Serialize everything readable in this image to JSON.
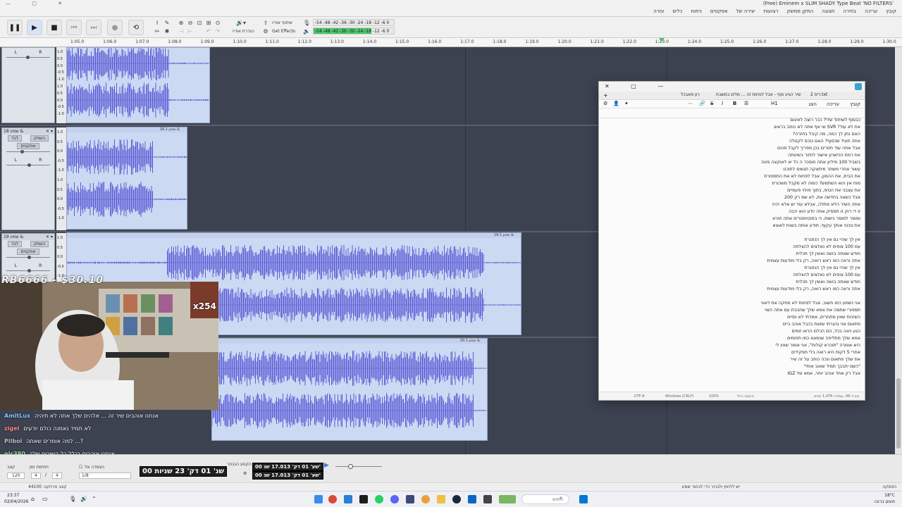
{
  "window": {
    "title": "(Free) Eminem x SLIM SHADY Type Beat 'NO FILTERS'"
  },
  "menu": [
    "קובץ",
    "עריכה",
    "בחירה",
    "תצוגה",
    "התקן ממשק",
    "רצועות",
    "יצירה של",
    "אפקטים",
    "ניתוח",
    "כלים",
    "עזרה"
  ],
  "toolbar": {
    "audio_setup_label": "שיתוף אודיו",
    "get_effects_label": "Get Effects",
    "audio_setup_sub": "הגדרת אודיו",
    "meter_top": "-54 -48 -42 -36 -30 -24 -18 -12 -6 0",
    "meter_bottom": "-54 -48 -42 -36 -30 -24 -18 -12 -6 0"
  },
  "ruler": {
    "ticks": [
      "1:05.0",
      "1:06.0",
      "1:07.0",
      "1:08.0",
      "1:09.0",
      "1:10.0",
      "1:11.0",
      "1:12.0",
      "1:13.0",
      "1:14.0",
      "1:15.0",
      "1:16.0",
      "1:17.0",
      "1:18.0",
      "1:19.0",
      "1:20.0",
      "1:21.0",
      "1:22.0",
      "1:23.0",
      "1:24.0",
      "1:25.0",
      "1:26.0",
      "1:27.0",
      "1:28.0",
      "1:29.0",
      "1:30.0"
    ]
  },
  "tracks": [
    {
      "name": "",
      "mute": "השתק",
      "solo": "לבד",
      "effects": "אפקטים",
      "clip_label": ""
    },
    {
      "name": "שמע 18 &",
      "mute": "השתק",
      "solo": "לבד",
      "effects": "אפקטים",
      "clip_label": "שמע 18.1 &"
    },
    {
      "name": "שמע 19 &",
      "mute": "השתק",
      "solo": "לבד",
      "effects": "אפקטים",
      "clip_label": "שמע 19.1 &"
    },
    {
      "name": "",
      "mute": "",
      "solo": "",
      "effects": "",
      "clip_label": "שמע 20.1 &"
    }
  ],
  "scale_labels": [
    "1.0",
    "0.5",
    "0.0",
    "-0.5",
    "-1.0",
    "1.0",
    "0.5",
    "0.0",
    "-0.5",
    "-1.0"
  ],
  "stream": {
    "donation": "RB6666 - $30.10",
    "gift_count": "x254",
    "chat": [
      {
        "user": "AmitLux",
        "text": "אנחנו אוהבים שיר זה ...  אלהים שלך אתה לא תיהיה"
      },
      {
        "user": "zigel",
        "text": "לא תמיד נאמנה כולם יודעים"
      },
      {
        "user": "Pilboi",
        "text": "למה אומרים שאתה ...?"
      },
      {
        "user": "nlc380",
        "text": "אנחנו אוהבים בגלל כל השירים שלך ..."
      }
    ]
  },
  "notepad": {
    "tabs": [
      "דיס 2.txt",
      "שיר הגיע סוף - אבל לפחות זה ... מלים במשבת",
      "רון מאבכל"
    ],
    "menu": [
      "קובץ",
      "עריכה",
      "הצג"
    ],
    "heading_btn": "H1",
    "lines": [
      "כבסוף לשיחוד שלי? כבר רוצה לאיגום",
      "את לא עוד? SVR שי אף אתה לא כותב בראש",
      "האם נתן לך כמה, מה קיבל בחזרה?",
      "אתה תעיד שכסוף? האם ננכס לקטלה",
      "אבל אתה עוד חוזרים בכן מפריך לקבל סכום",
      "את רמת הכישרון אישור לחזור בשיטתה",
      "בשביל 100 מיליון אתה חוסכר ה כל יא לאוקצה פטה",
      "עשור אחרי משחר מיתאקה תגשים לתוכנו",
      "את הבית, את ההמון, אבל לפחות לא את התספורת",
      "מוח אין הוא השתמש? כשזה לא מקבל משכורת",
      "את עצבני את הטיפ, בתוך פולוי פעמיים",
      "אבל כשאני בחדשה את, לא שם רק 200",
      "אתה השיר הלא מתלה, אבלא עוד יש אלא יהיה",
      "זו די רוק זו תפסיק אתה יודע הוא יכבה",
      "ומוסר למוסר גישות, כי בסנטימטרים אתה חורא",
      "את טכנוי אותך עקוף, תודע אותה בשנת לאוצא",
      "",
      "אין לך שהיי גם אין לך הנפגרת",
      "עם 100 צופים לא נאלצים להצלחה",
      "חודש שאתה בושה ואשין לך תכלית",
      "אתה וראה כמו ראש רואה, רק בלי מודעות עצמית",
      "אין לך שהיי גם אין לך הנפגרת",
      "עם 100 צופים לא נאלצים להצלחה",
      "חודש שאתה בושה ואשין לך תכלית",
      "אתה וראה כמו ראש רואה, רק בלי מודעות עצמית",
      "",
      "אני נשמע כמו חשוב, אבל לפחות לא מחקה את דאווי",
      "תספורי שתמה את אמא שלך שחבבת עם אתה כשוי",
      "השיבות שאין מתחרים, אמרתי לא נסיים",
      "פתאום אני נהגרתי שזאת בכבל אוהב ביים",
      "הגע ויאה בכל, הם הכלם הראו זומים",
      "אמא שלך מתליפה שנמצא כמו תחומים",
      "היא אומרה \"תוכרא קולות\", אני אומר שאין לי",
      "אחרי 5 דקות היא רואה בלי תפקידים",
      "את שלך פתאום ונכה כותב על זה שיר",
      "\"כשם יחבבך תמיד שאוב אותי\"",
      "אבל רק אחד אוהב יותר, אמא של IGZ"
    ],
    "status": {
      "position": "שורה 46, עמודה 1,476 תווים",
      "text_type": "טקסט רגיל",
      "zoom": "100%",
      "line_ending": "Windows (CRLF)",
      "encoding": "UTF-8"
    }
  },
  "bottom": {
    "rate_label": "קצב",
    "rate_value": "120",
    "time_sig_label": "חתימת זמן",
    "time_sig_num": "4",
    "time_sig_den": "4",
    "snap_label": "הצמדה אל",
    "snap_value": "1/8",
    "big_time": "00 שנ' 01 דק' 23 שניות",
    "sel_label": "הקטע הנבחר",
    "sel_start": "00 שע' 01 דק' 17.013 שנ'",
    "sel_end": "00 שע' 01 דק' 17.013 שנ'",
    "project_rate": "קצב פרויקט: 44100"
  },
  "status_bar": {
    "left": "הפסקה",
    "right": "יש ללחוץ ולגרור כדי לבחור שמע"
  },
  "taskbar": {
    "search_placeholder": "חיפוש",
    "time": "23:37",
    "date": "02/04/2026",
    "weather_temp": "18°C",
    "weather_text": "מעונן ברובו"
  },
  "colors": {
    "waveform": "#5b5bd6",
    "track_bg": "#3c4250",
    "clip_bg": "#cbd9f2",
    "meter_green": "#4ec36a"
  }
}
